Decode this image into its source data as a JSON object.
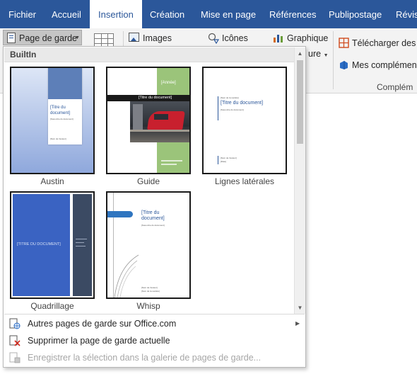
{
  "tabs": [
    {
      "label": "Fichier",
      "active": false
    },
    {
      "label": "Accueil",
      "active": false
    },
    {
      "label": "Insertion",
      "active": true
    },
    {
      "label": "Création",
      "active": false
    },
    {
      "label": "Mise en page",
      "active": false
    },
    {
      "label": "Références",
      "active": false
    },
    {
      "label": "Publipostage",
      "active": false
    },
    {
      "label": "Révisi",
      "active": false
    }
  ],
  "ribbon": {
    "cover_page_button": "Page de garde",
    "images_button": "Images",
    "icons_button": "Icônes",
    "chart_button": "Graphique",
    "capture_button_partial": "ure",
    "download_addins": "Télécharger des co",
    "my_addins": "Mes complément",
    "addins_group_label": "Complém"
  },
  "gallery": {
    "section_header": "BuiltIn",
    "items": [
      {
        "name": "Austin",
        "title_text": "[Titre du document]",
        "subtitle_text": "[Sous-titre du document]",
        "author_text": "[Nom de l'auteur]"
      },
      {
        "name": "Guide",
        "year_text": "[Année]",
        "title_text": "[Titre du document]"
      },
      {
        "name": "Lignes latérales",
        "title_text": "[Titre du document]",
        "company_text": "[Nom de la société]",
        "subtitle_text": "[Sous-titre du document]",
        "author_text": "[Nom de l'auteur]",
        "date_text": "[Date]"
      },
      {
        "name": "Quadrillage",
        "title_text": "[TITRE DU DOCUMENT]"
      },
      {
        "name": "Whisp",
        "title_line1": "[Titre du",
        "title_line2": "document]",
        "subtitle_text": "[Sous-titre du document]",
        "author_text": "[Nom de l'auteur]",
        "company_text": "[Nom de la société]"
      }
    ]
  },
  "menu": {
    "more_online": "Autres pages de garde sur Office.com",
    "remove_current": "Supprimer la page de garde actuelle",
    "save_selection": "Enregistrer la sélection dans la galerie de pages de garde..."
  },
  "colors": {
    "ribbon_blue": "#2b579a",
    "austin_blue": "#8fa8dc",
    "guide_green": "#9bc47a",
    "guide_red": "#c8202e",
    "quad_blue": "#3a63c2",
    "quad_slate": "#3b4a63",
    "whisp_blue": "#2f75c0"
  }
}
